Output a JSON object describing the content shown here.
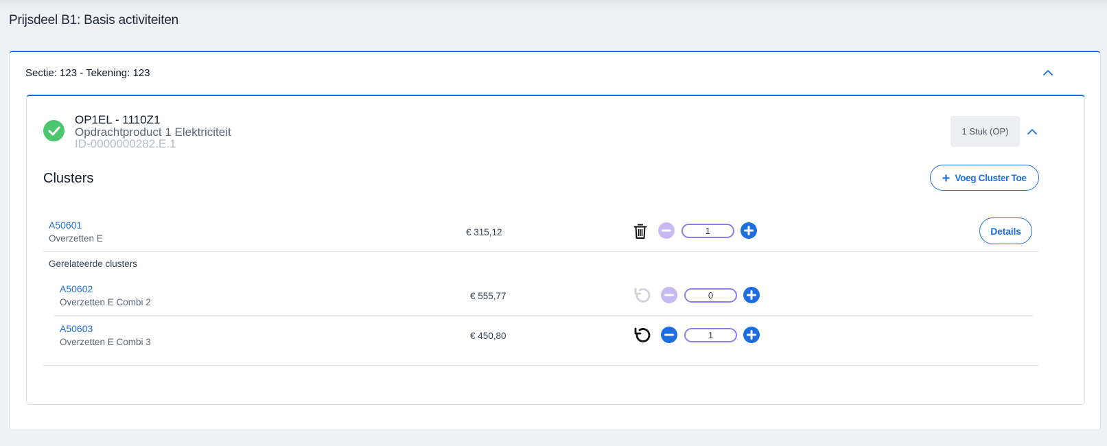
{
  "page": {
    "title": "Prijsdeel B1: Basis activiteiten"
  },
  "section": {
    "title": "Sectie: 123 - Tekening: 123"
  },
  "product": {
    "code": "OP1EL - 1110Z1",
    "name": "Opdrachtproduct 1 Elektriciteit",
    "id": "ID-0000000282.E.1",
    "unit_badge": "1 Stuk (OP)"
  },
  "clusters": {
    "title": "Clusters",
    "add_label": "Voeg Cluster Toe",
    "related_label": "Gerelateerde clusters",
    "details_label": "Details",
    "main": {
      "code": "A50601",
      "desc": "Overzetten E",
      "price": "€ 315,12",
      "qty": "1"
    },
    "related": [
      {
        "code": "A50602",
        "desc": "Overzetten E Combi 2",
        "price": "€ 555,77",
        "qty": "0"
      },
      {
        "code": "A50603",
        "desc": "Overzetten E Combi 3",
        "price": "€ 450,80",
        "qty": "1"
      }
    ]
  },
  "colors": {
    "accent": "#1e6ee0",
    "success": "#4cc76f",
    "minus_disabled": "#c9b9f3",
    "qty_border": "#8c7cf0"
  },
  "icons": {
    "check": "check-circle-icon",
    "collapse": "chevron-up-icon",
    "delete": "trash-icon",
    "undo": "undo-icon",
    "minus": "minus-circle-icon",
    "plus": "plus-circle-icon"
  }
}
